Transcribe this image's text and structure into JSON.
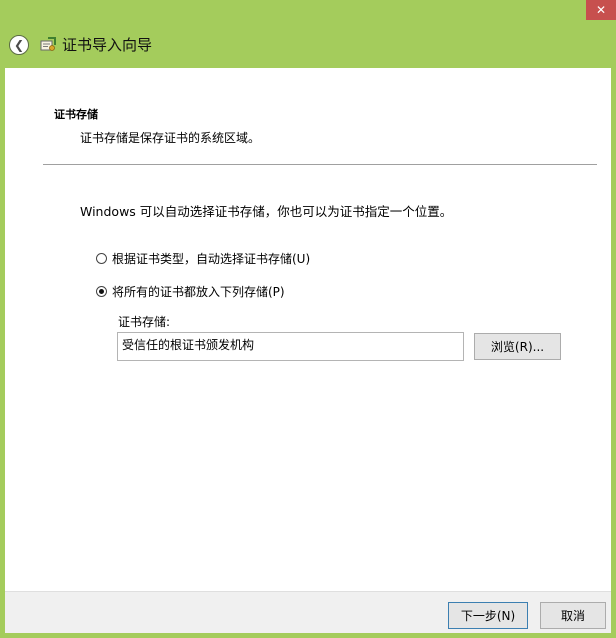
{
  "window": {
    "title": "证书导入向导",
    "close_glyph": "✕",
    "back_glyph": "❮"
  },
  "page": {
    "section_title": "证书存储",
    "section_desc": "证书存储是保存证书的系统区域。",
    "intro": "Windows 可以自动选择证书存储，你也可以为证书指定一个位置。"
  },
  "options": [
    {
      "label": "根据证书类型，自动选择证书存储(U)",
      "checked": false
    },
    {
      "label": "将所有的证书都放入下列存储(P)",
      "checked": true
    }
  ],
  "store": {
    "label": "证书存储:",
    "value": "受信任的根证书颁发机构",
    "browse_label": "浏览(R)..."
  },
  "footer": {
    "next_label": "下一步(N)",
    "cancel_label": "取消"
  },
  "colors": {
    "title_bar": "#a4cc5c",
    "close_button": "#c7504e",
    "content_bg": "#ffffff",
    "footer_bg": "#f0f0f0"
  }
}
